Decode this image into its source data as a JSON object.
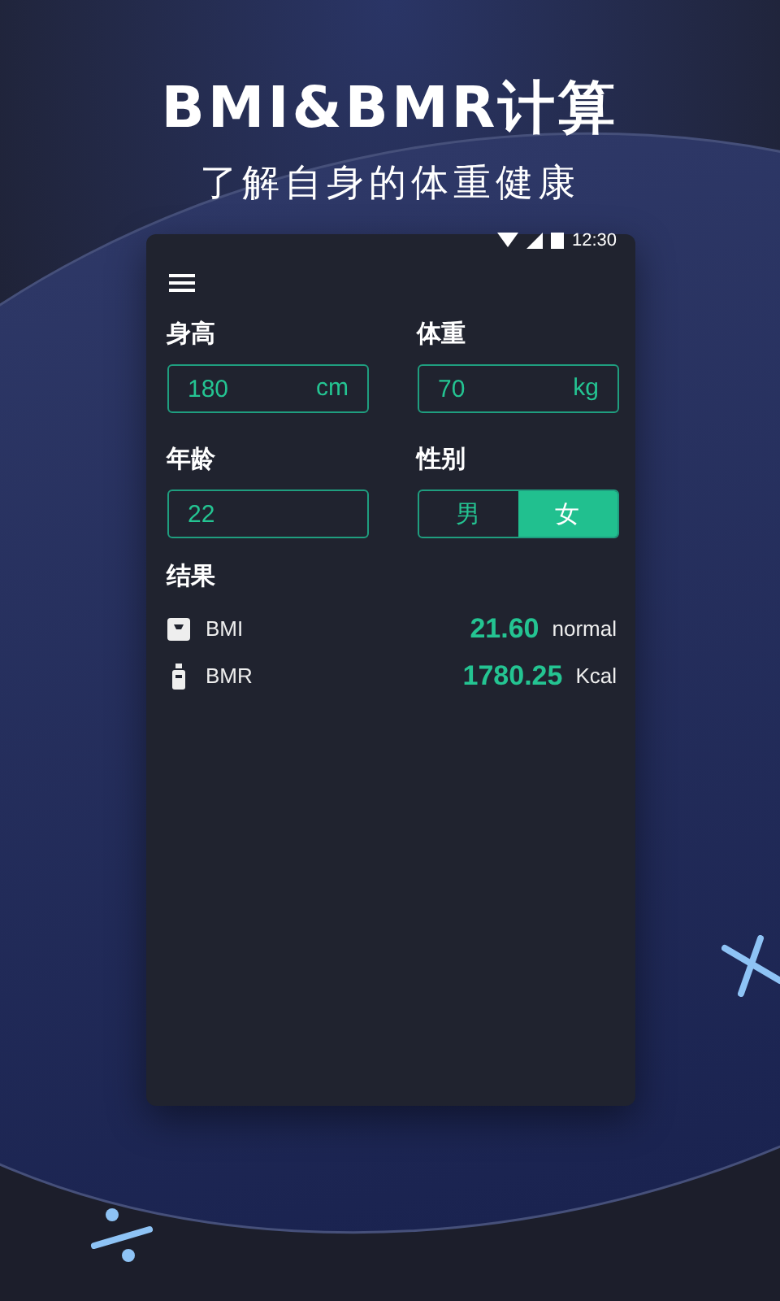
{
  "header": {
    "title": "BMI&BMR计算",
    "subtitle": "了解自身的体重健康"
  },
  "status_bar": {
    "time": "12:30"
  },
  "fields": [
    {
      "label": "身高",
      "kind": "input",
      "value": "180",
      "unit": "cm"
    },
    {
      "label": "体重",
      "kind": "input",
      "value": "70",
      "unit": "kg"
    },
    {
      "label": "年龄",
      "kind": "input",
      "value": "22"
    },
    {
      "label": "性别",
      "kind": "toggle",
      "options": [
        {
          "label": "男",
          "selected": false
        },
        {
          "label": "女",
          "selected": true
        }
      ]
    }
  ],
  "results": {
    "title": "结果",
    "rows": [
      {
        "kind": "scale",
        "name": "BMI",
        "value": "21.60",
        "unit": "normal"
      },
      {
        "kind": "bottle",
        "name": "BMR",
        "value": "1780.25",
        "unit": "Kcal"
      }
    ]
  }
}
